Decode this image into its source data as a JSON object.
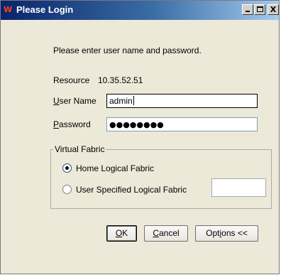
{
  "window": {
    "title": "Please Login",
    "logo_text": "W",
    "title_buttons": {
      "minimize": "minimize",
      "maximize": "maximize",
      "close": "X"
    }
  },
  "prompt": "Please enter user name and password.",
  "resource": {
    "label": "Resource",
    "value": "10.35.52.51"
  },
  "username": {
    "label_mnemonic": "U",
    "label_rest": "ser Name",
    "value": "admin"
  },
  "password": {
    "label_mnemonic": "P",
    "label_rest": "assword",
    "masked_value": "●●●●●●●●",
    "length": 8
  },
  "virtual_fabric": {
    "legend": "Virtual Fabric",
    "options": [
      {
        "label": "Home Logical Fabric",
        "selected": true
      },
      {
        "label": "User Specified Logical Fabric",
        "selected": false
      }
    ],
    "logical_fabric_value": ""
  },
  "buttons": {
    "ok": {
      "mnemonic": "O",
      "rest": "K"
    },
    "cancel": {
      "mnemonic": "C",
      "rest": "ancel"
    },
    "options": {
      "pre": "Opt",
      "mnemonic": "i",
      "rest": "ons <<"
    }
  },
  "colors": {
    "titlebar_start": "#0a246a",
    "titlebar_end": "#a6caf0",
    "dialog_bg": "#ece9d8"
  }
}
